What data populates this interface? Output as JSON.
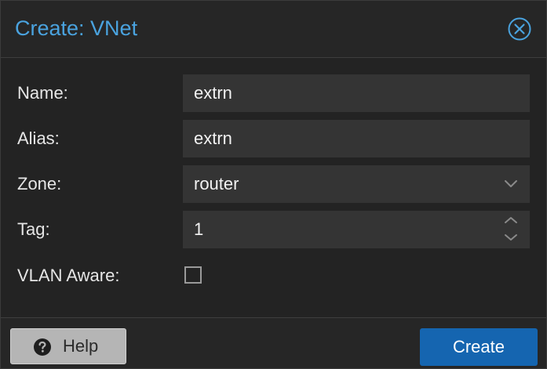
{
  "dialog": {
    "title": "Create: VNet",
    "close_icon": "close-circle-icon",
    "accent_color": "#4aa3df"
  },
  "form": {
    "name": {
      "label": "Name:",
      "value": "extrn"
    },
    "alias": {
      "label": "Alias:",
      "value": "extrn"
    },
    "zone": {
      "label": "Zone:",
      "value": "router",
      "icon": "chevron-down-icon"
    },
    "tag": {
      "label": "Tag:",
      "value": "1",
      "icon": "spinner-icon"
    },
    "vlan_aware": {
      "label": "VLAN Aware:",
      "checked": false
    }
  },
  "footer": {
    "help_label": "Help",
    "help_icon": "question-circle-icon",
    "create_label": "Create",
    "create_color": "#1565b0"
  }
}
